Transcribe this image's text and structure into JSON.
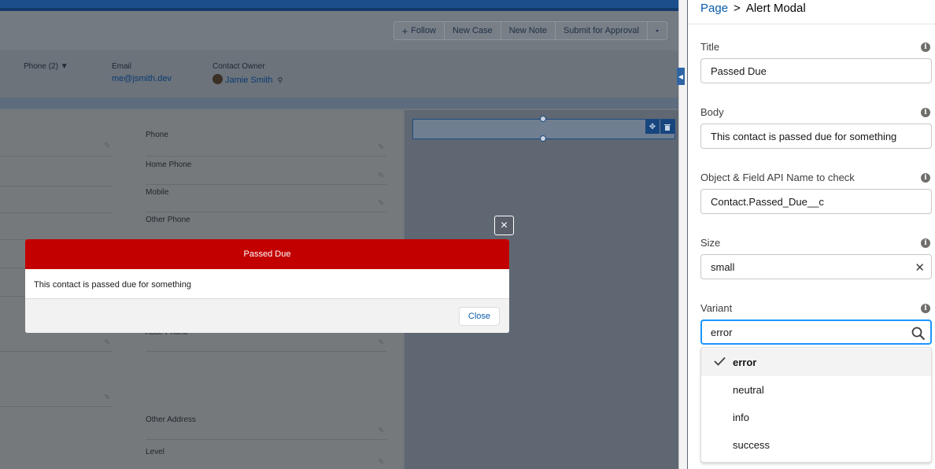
{
  "record": {
    "actions": [
      "Follow",
      "New Case",
      "New Note",
      "Submit for Approval"
    ],
    "follow_prefix": "+",
    "highlights": {
      "phone_label": "Phone (2) ▼",
      "email_label": "Email",
      "email_value": "me@jsmith.dev",
      "owner_label": "Contact Owner",
      "owner_value": "Jamie Smith"
    },
    "fields": [
      "Phone",
      "Home Phone",
      "Mobile",
      "Other Phone",
      "Other Address",
      "Level"
    ],
    "partial_field": "Asst. Phone"
  },
  "modal": {
    "title": "Passed Due",
    "body": "This contact is passed due for something",
    "close_button": "Close",
    "close_icon": "×",
    "header_color": "#c30000"
  },
  "panel": {
    "breadcrumb_link": "Page",
    "breadcrumb_sep": ">",
    "breadcrumb_current": "Alert Modal",
    "title_label": "Title",
    "title_value": "Passed Due",
    "body_label": "Body",
    "body_value": "This contact is passed due for something",
    "field_label": "Object & Field API Name to check",
    "field_value": "Contact.Passed_Due__c",
    "size_label": "Size",
    "size_value": "small",
    "variant_label": "Variant",
    "variant_value": "error",
    "variant_options": [
      "error",
      "neutral",
      "info",
      "success"
    ],
    "selected_option": "error",
    "info_glyph": "i",
    "clear_glyph": "✕"
  }
}
